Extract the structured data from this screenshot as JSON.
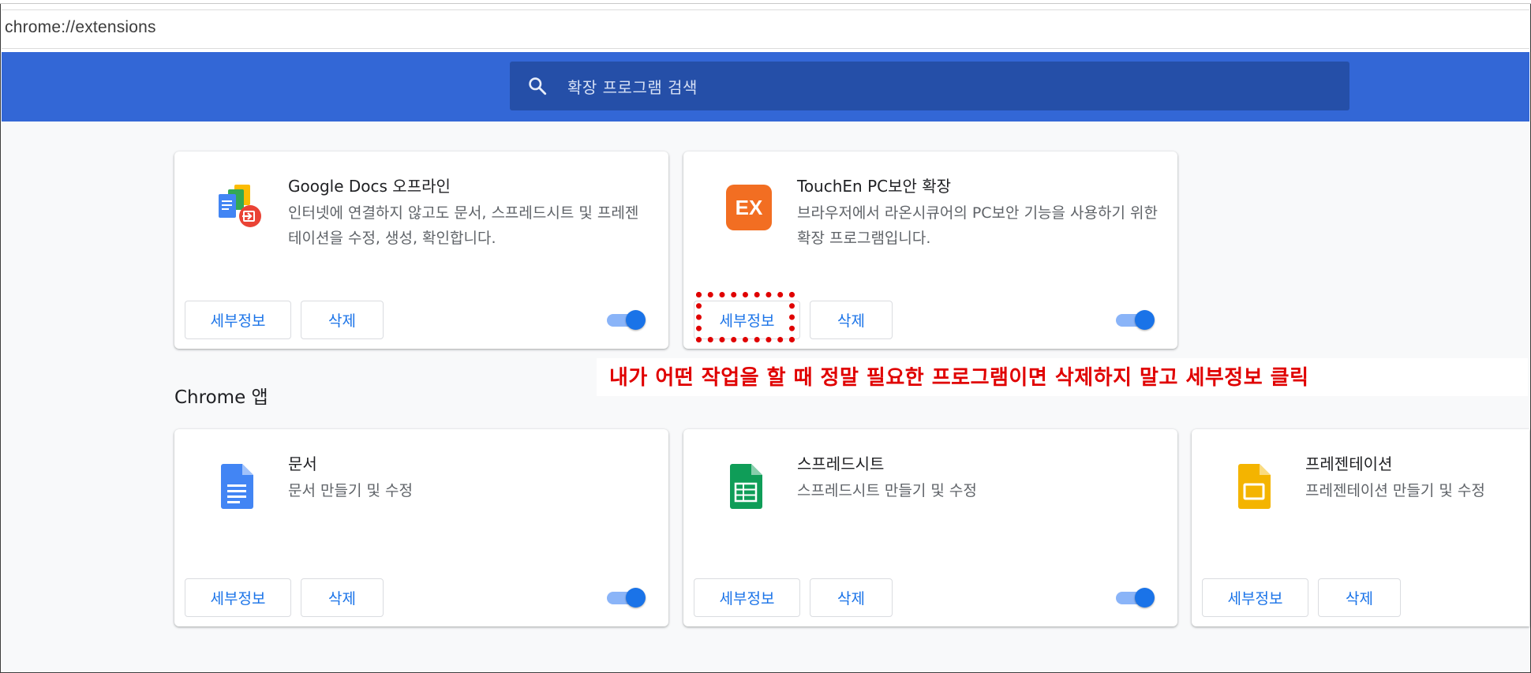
{
  "browser": {
    "address": "chrome://extensions"
  },
  "search": {
    "placeholder": "확장 프로그램 검색"
  },
  "extensions": [
    {
      "title": "Google Docs 오프라인",
      "description": "인터넷에 연결하지 않고도 문서, 스프레드시트 및 프레젠테이션을 수정, 생성, 확인합니다.",
      "details_label": "세부정보",
      "remove_label": "삭제",
      "enabled": true
    },
    {
      "title": "TouchEn PC보안 확장",
      "description": "브라우저에서 라온시큐어의 PC보안 기능을 사용하기 위한 확장 프로그램입니다.",
      "icon_text": "EX",
      "details_label": "세부정보",
      "remove_label": "삭제",
      "enabled": true
    }
  ],
  "apps_section": {
    "title": "Chrome 앱"
  },
  "apps": [
    {
      "title": "문서",
      "description": "문서 만들기 및 수정",
      "details_label": "세부정보",
      "remove_label": "삭제",
      "enabled": true
    },
    {
      "title": "스프레드시트",
      "description": "스프레드시트 만들기 및 수정",
      "details_label": "세부정보",
      "remove_label": "삭제",
      "enabled": true
    },
    {
      "title": "프레젠테이션",
      "description": "프레젠테이션 만들기 및 수정",
      "details_label": "세부정보",
      "remove_label": "삭제"
    }
  ],
  "annotation": {
    "text": "내가 어떤 작업을 할 때 정말 필요한 프로그램이면 삭제하지 말고 세부정보 클릭"
  },
  "colors": {
    "header_blue": "#3367d6",
    "search_box": "#254fa8",
    "link_blue": "#1a73e8",
    "annotation_red": "#e00000"
  }
}
